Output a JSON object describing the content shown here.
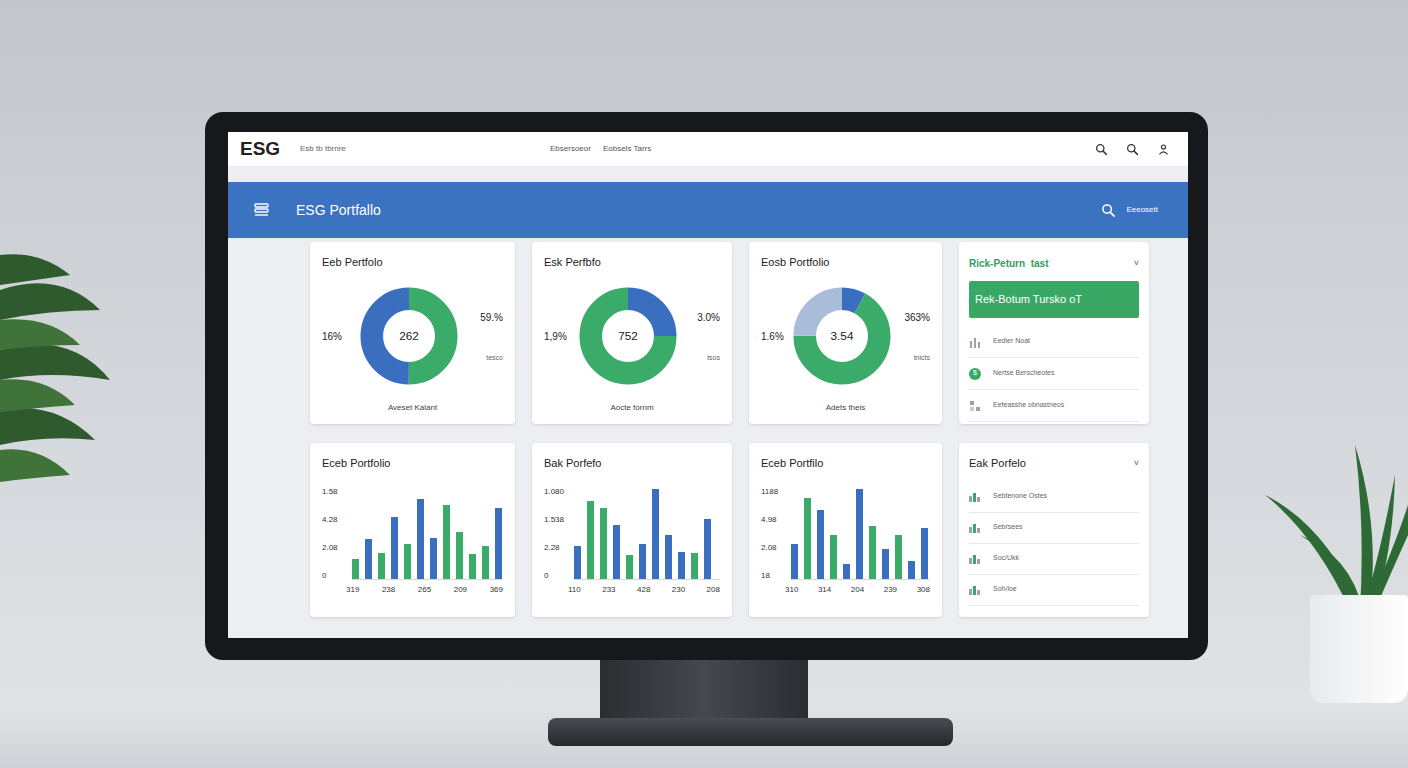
{
  "top_bar": {
    "logo": "ESG",
    "subtitle": "Esb tb tbrnre",
    "center_links": [
      "Ebsersoeor",
      "Eobsels Tarrs"
    ]
  },
  "header": {
    "title": "ESG Portfallo",
    "search_label": "Eeeosett"
  },
  "donut_cards": [
    {
      "title": "Eeb Pertfolo",
      "left_label": "16%",
      "right_top": "59.%",
      "right_mid": "tesco",
      "center": "262",
      "caption": "Aveset Kalant",
      "segments": [
        {
          "value": 50,
          "color": "#3bab6a"
        },
        {
          "value": 50,
          "color": "#3a6fc0"
        }
      ]
    },
    {
      "title": "Esk Perfbfo",
      "left_label": "1,9%",
      "right_top": "3.0%",
      "right_mid": "tsos",
      "center": "752",
      "caption": "Aocte fornm",
      "segments": [
        {
          "value": 25,
          "color": "#3a6fc0"
        },
        {
          "value": 75,
          "color": "#3bab6a"
        }
      ]
    },
    {
      "title": "Eosb Portfolio",
      "left_label": "1.6%",
      "right_top": "363%",
      "right_mid": "tnicts",
      "center": "3.54",
      "caption": "Adets theis",
      "segments": [
        {
          "value": 8,
          "color": "#3a6fc0"
        },
        {
          "value": 67,
          "color": "#3bab6a"
        },
        {
          "value": 25,
          "color": "#a9bddb"
        }
      ]
    }
  ],
  "side_panel": {
    "title": "Rick-Peturn  tast",
    "chevron": "˅",
    "button": "Rek-Botum Tursko oT",
    "items": [
      {
        "label": "Eedier Noat",
        "kind": "chart"
      },
      {
        "label": "Nertse Berscheotes",
        "kind": "coin",
        "icon_text": "$"
      },
      {
        "label": "Eefeasshe obnastneos",
        "kind": "grid"
      }
    ]
  },
  "bar_cards": [
    {
      "title": "Eceb Portfolio",
      "y_ticks": [
        "1.58",
        "4.28",
        "2.08",
        "0"
      ],
      "x_ticks": [
        "319",
        "238",
        "265",
        "209",
        "369"
      ],
      "bars": [
        {
          "value": 22,
          "color": "#3bab6a"
        },
        {
          "value": 44,
          "color": "#3a6fc0"
        },
        {
          "value": 28,
          "color": "#3bab6a"
        },
        {
          "value": 68,
          "color": "#3a6fc0"
        },
        {
          "value": 38,
          "color": "#3bab6a"
        },
        {
          "value": 88,
          "color": "#3a6fc0"
        },
        {
          "value": 45,
          "color": "#3a6fc0"
        },
        {
          "value": 82,
          "color": "#3bab6a"
        },
        {
          "value": 52,
          "color": "#3bab6a"
        },
        {
          "value": 27,
          "color": "#3bab6a"
        },
        {
          "value": 36,
          "color": "#3bab6a"
        },
        {
          "value": 78,
          "color": "#3a6fc0"
        }
      ]
    },
    {
      "title": "Bak Porfefo",
      "y_ticks": [
        "1.080",
        "1.538",
        "2.28",
        "0"
      ],
      "x_ticks": [
        "110",
        "233",
        "428",
        "230",
        "208"
      ],
      "bars": [
        {
          "value": 36,
          "color": "#3a6fc0"
        },
        {
          "value": 86,
          "color": "#3bab6a"
        },
        {
          "value": 78,
          "color": "#3bab6a"
        },
        {
          "value": 60,
          "color": "#3a6fc0"
        },
        {
          "value": 26,
          "color": "#3bab6a"
        },
        {
          "value": 38,
          "color": "#3a6fc0"
        },
        {
          "value": 100,
          "color": "#3a6fc0"
        },
        {
          "value": 48,
          "color": "#3a6fc0"
        },
        {
          "value": 30,
          "color": "#3a6fc0"
        },
        {
          "value": 28,
          "color": "#3bab6a"
        },
        {
          "value": 66,
          "color": "#3a6fc0"
        }
      ]
    },
    {
      "title": "Eceb Portfilo",
      "y_ticks": [
        "1188",
        "4.98",
        "2.08",
        "18"
      ],
      "x_ticks": [
        "310",
        "314",
        "204",
        "239",
        "308"
      ],
      "bars": [
        {
          "value": 38,
          "color": "#3a6fc0"
        },
        {
          "value": 90,
          "color": "#3bab6a"
        },
        {
          "value": 76,
          "color": "#3a6fc0"
        },
        {
          "value": 48,
          "color": "#3bab6a"
        },
        {
          "value": 16,
          "color": "#3a6fc0"
        },
        {
          "value": 100,
          "color": "#3a6fc0"
        },
        {
          "value": 58,
          "color": "#3bab6a"
        },
        {
          "value": 33,
          "color": "#3a6fc0"
        },
        {
          "value": 48,
          "color": "#3bab6a"
        },
        {
          "value": 20,
          "color": "#3a6fc0"
        },
        {
          "value": 56,
          "color": "#3a6fc0"
        }
      ]
    }
  ],
  "side_panel_2": {
    "title": "Eak Porfelo",
    "chevron": "˅",
    "items": [
      {
        "label": "Sebtenone Ostes"
      },
      {
        "label": "Sebrsees"
      },
      {
        "label": "Soc/Ukk"
      },
      {
        "label": "Soh/loe"
      }
    ]
  }
}
